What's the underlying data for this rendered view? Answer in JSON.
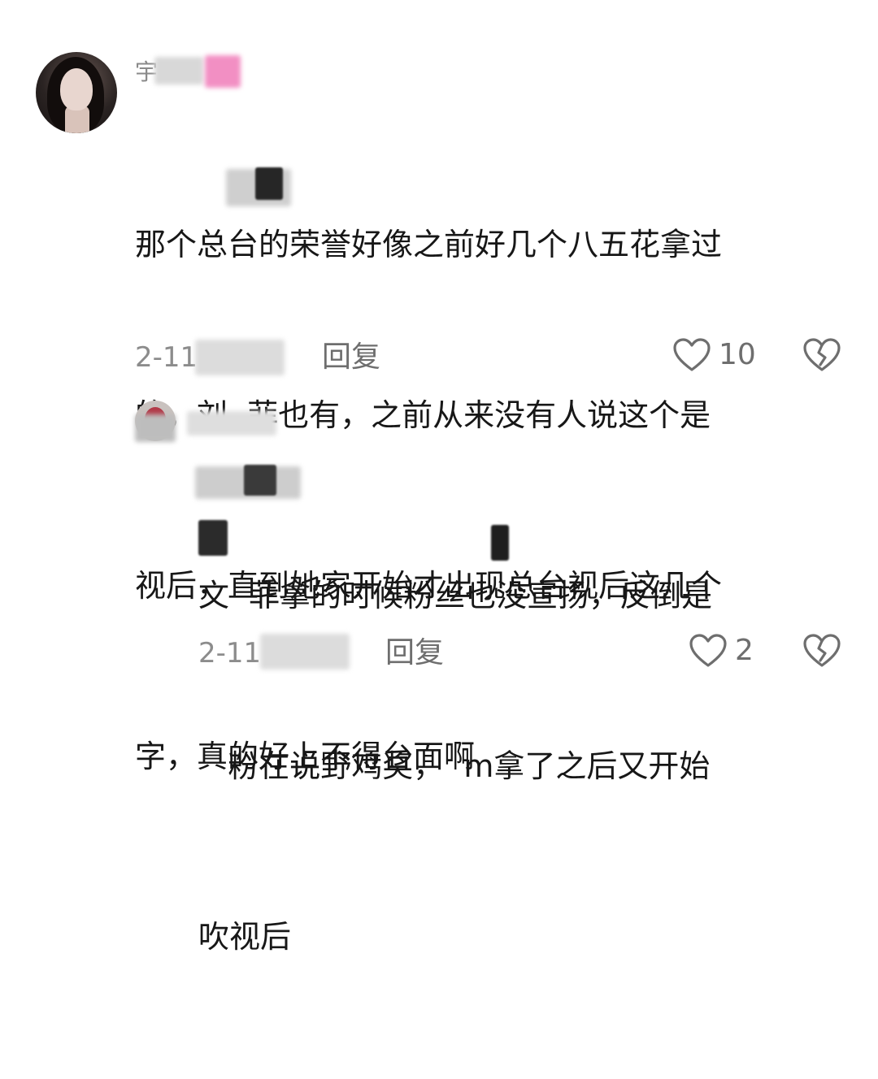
{
  "comments": [
    {
      "username": "宇",
      "text": "那个总台的荣誉好像之前好几个八五花拿过的，刘  菲也有，之前从来没有人说这个是视后，直到她家开始才出现总台视后这几个字，真的好上不得台面啊",
      "lines": [
        "那个总台的荣誉好像之前好几个八五花拿过",
        "的，刘  菲也有，之前从来没有人说这个是",
        "视后，直到她家开始才出现总台视后这几个",
        "字，真的好上不得台面啊"
      ],
      "date": "2-11",
      "reply_label": "回复",
      "likes": "10"
    },
    {
      "username": "",
      "lines": [
        "文  菲拿的时候粉丝也没宣扬，反倒是",
        "   粉在说野鸡奖，  m拿了之后又开始",
        "吹视后"
      ],
      "date": "2-11",
      "reply_label": "回复",
      "likes": "2"
    }
  ],
  "icons": {
    "like": "heart-outline-icon",
    "dislike": "broken-heart-icon"
  },
  "colors": {
    "text": "#171717",
    "meta": "#8c8c8c",
    "icon": "#6e6e6e"
  }
}
